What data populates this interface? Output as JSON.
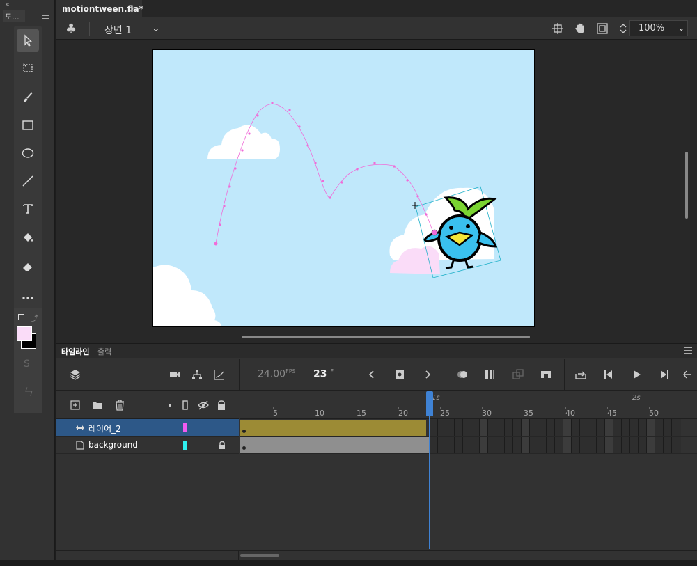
{
  "tools_panel": {
    "collapse": "«",
    "tab_label": "도...",
    "tools": [
      "selection-tool",
      "free-transform-tool",
      "brush-tool",
      "rectangle-tool",
      "oval-tool",
      "line-tool",
      "text-tool",
      "paint-bucket-tool",
      "eraser-tool",
      "more-tools"
    ],
    "stroke_color": "#000000",
    "fill_color": "#fadcf8"
  },
  "document": {
    "tab_title": "motiontween.fla*",
    "close": "×"
  },
  "editbar": {
    "scene_label": "장면 1",
    "zoom": "100%"
  },
  "stage": {
    "background": "#c0e8fb"
  },
  "timeline": {
    "tab_timeline": "타임라인",
    "tab_output": "출력",
    "fps_value": "24.00",
    "fps_unit": "FPS",
    "current_frame": "23",
    "frame_unit": "F",
    "ruler_ticks": [
      "5",
      "10",
      "15",
      "20",
      "25",
      "30",
      "35",
      "40",
      "45",
      "50"
    ],
    "second_markers": [
      "1s",
      "2s"
    ],
    "layers": [
      {
        "name": "레이어_2",
        "color": "#f05bf0",
        "selected": true,
        "locked": false
      },
      {
        "name": "background",
        "color": "#2ff0f0",
        "selected": false,
        "locked": true
      }
    ],
    "tween_color": "#9c8b35",
    "static_span_color": "#8f8f8f"
  }
}
